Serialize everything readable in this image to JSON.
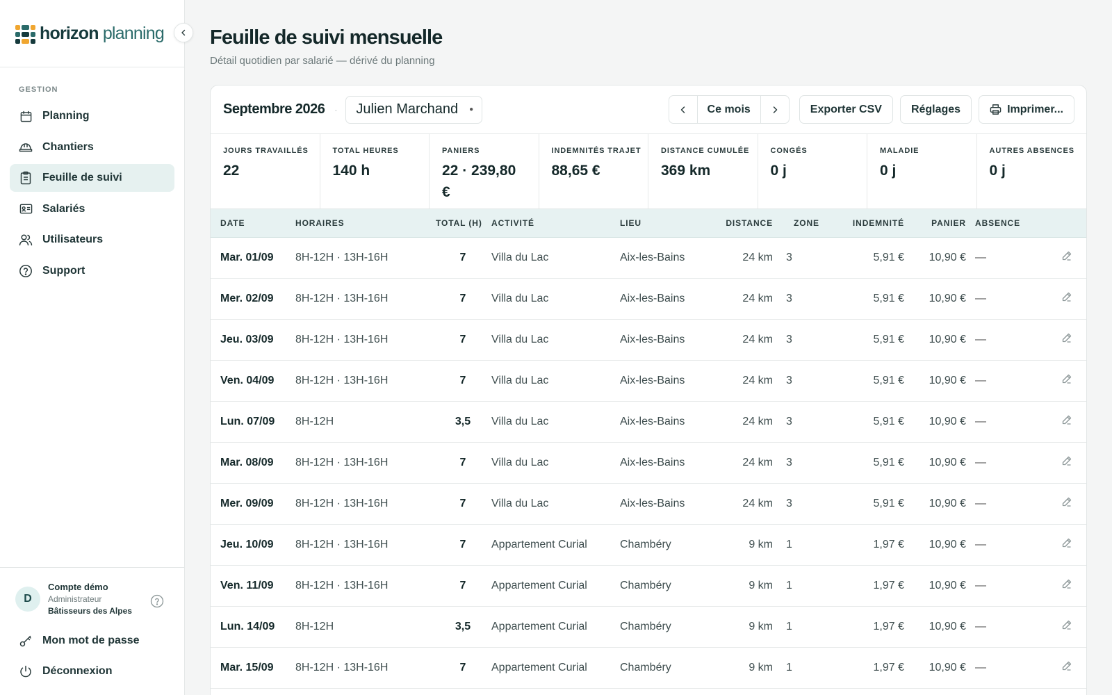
{
  "brand": {
    "bold": "horizon",
    "light": " planning"
  },
  "colors": {
    "accent": "#e6f1f0",
    "logo": [
      "#f0a630",
      "#2b6b6a",
      "#163a3c"
    ]
  },
  "sidebar": {
    "section": "GESTION",
    "items": [
      {
        "label": "Planning",
        "icon": "calendar-icon"
      },
      {
        "label": "Chantiers",
        "icon": "hardhat-icon"
      },
      {
        "label": "Feuille de suivi",
        "icon": "clipboard-icon",
        "active": true
      },
      {
        "label": "Salariés",
        "icon": "id-card-icon"
      },
      {
        "label": "Utilisateurs",
        "icon": "users-icon"
      },
      {
        "label": "Support",
        "icon": "help-circle-icon"
      }
    ],
    "account": {
      "initial": "D",
      "name": "Compte démo",
      "role": "Administrateur",
      "org": "Bâtisseurs des Alpes"
    },
    "footer": [
      {
        "label": "Mon mot de passe",
        "icon": "key-icon"
      },
      {
        "label": "Déconnexion",
        "icon": "power-icon"
      }
    ]
  },
  "page": {
    "title": "Feuille de suivi mensuelle",
    "subtitle": "Détail quotidien par salarié — dérivé du planning"
  },
  "toolbar": {
    "month": "Septembre 2026",
    "employee": "Julien Marchand",
    "current": "Ce mois",
    "export": "Exporter CSV",
    "settings": "Réglages",
    "print": "Imprimer..."
  },
  "stats": [
    {
      "label": "Jours travaillés",
      "value": "22"
    },
    {
      "label": "Total heures",
      "value": "140 h"
    },
    {
      "label": "Paniers",
      "value": "22 · 239,80 €"
    },
    {
      "label": "Indemnités trajet",
      "value": "88,65 €"
    },
    {
      "label": "Distance cumulée",
      "value": "369 km"
    },
    {
      "label": "Congés",
      "value": "0 j"
    },
    {
      "label": "Maladie",
      "value": "0 j"
    },
    {
      "label": "Autres absences",
      "value": "0 j"
    }
  ],
  "table": {
    "headers": [
      "Date",
      "Horaires",
      "Total (h)",
      "Activité",
      "Lieu",
      "Distance",
      "Zone",
      "Indemnité",
      "Panier",
      "Absence"
    ],
    "rows": [
      {
        "date": "Mar. 01/09",
        "horaires": "8H-12H · 13H-16H",
        "total": "7",
        "activite": "Villa du Lac",
        "lieu": "Aix-les-Bains",
        "distance": "24 km",
        "zone": "3",
        "indemnite": "5,91 €",
        "panier": "10,90 €",
        "absence": "—"
      },
      {
        "date": "Mer. 02/09",
        "horaires": "8H-12H · 13H-16H",
        "total": "7",
        "activite": "Villa du Lac",
        "lieu": "Aix-les-Bains",
        "distance": "24 km",
        "zone": "3",
        "indemnite": "5,91 €",
        "panier": "10,90 €",
        "absence": "—"
      },
      {
        "date": "Jeu. 03/09",
        "horaires": "8H-12H · 13H-16H",
        "total": "7",
        "activite": "Villa du Lac",
        "lieu": "Aix-les-Bains",
        "distance": "24 km",
        "zone": "3",
        "indemnite": "5,91 €",
        "panier": "10,90 €",
        "absence": "—"
      },
      {
        "date": "Ven. 04/09",
        "horaires": "8H-12H · 13H-16H",
        "total": "7",
        "activite": "Villa du Lac",
        "lieu": "Aix-les-Bains",
        "distance": "24 km",
        "zone": "3",
        "indemnite": "5,91 €",
        "panier": "10,90 €",
        "absence": "—"
      },
      {
        "date": "Lun. 07/09",
        "horaires": "8H-12H",
        "total": "3,5",
        "activite": "Villa du Lac",
        "lieu": "Aix-les-Bains",
        "distance": "24 km",
        "zone": "3",
        "indemnite": "5,91 €",
        "panier": "10,90 €",
        "absence": "—"
      },
      {
        "date": "Mar. 08/09",
        "horaires": "8H-12H · 13H-16H",
        "total": "7",
        "activite": "Villa du Lac",
        "lieu": "Aix-les-Bains",
        "distance": "24 km",
        "zone": "3",
        "indemnite": "5,91 €",
        "panier": "10,90 €",
        "absence": "—"
      },
      {
        "date": "Mer. 09/09",
        "horaires": "8H-12H · 13H-16H",
        "total": "7",
        "activite": "Villa du Lac",
        "lieu": "Aix-les-Bains",
        "distance": "24 km",
        "zone": "3",
        "indemnite": "5,91 €",
        "panier": "10,90 €",
        "absence": "—"
      },
      {
        "date": "Jeu. 10/09",
        "horaires": "8H-12H · 13H-16H",
        "total": "7",
        "activite": "Appartement Curial",
        "lieu": "Chambéry",
        "distance": "9 km",
        "zone": "1",
        "indemnite": "1,97 €",
        "panier": "10,90 €",
        "absence": "—"
      },
      {
        "date": "Ven. 11/09",
        "horaires": "8H-12H · 13H-16H",
        "total": "7",
        "activite": "Appartement Curial",
        "lieu": "Chambéry",
        "distance": "9 km",
        "zone": "1",
        "indemnite": "1,97 €",
        "panier": "10,90 €",
        "absence": "—"
      },
      {
        "date": "Lun. 14/09",
        "horaires": "8H-12H",
        "total": "3,5",
        "activite": "Appartement Curial",
        "lieu": "Chambéry",
        "distance": "9 km",
        "zone": "1",
        "indemnite": "1,97 €",
        "panier": "10,90 €",
        "absence": "—"
      },
      {
        "date": "Mar. 15/09",
        "horaires": "8H-12H · 13H-16H",
        "total": "7",
        "activite": "Appartement Curial",
        "lieu": "Chambéry",
        "distance": "9 km",
        "zone": "1",
        "indemnite": "1,97 €",
        "panier": "10,90 €",
        "absence": "—"
      }
    ]
  }
}
